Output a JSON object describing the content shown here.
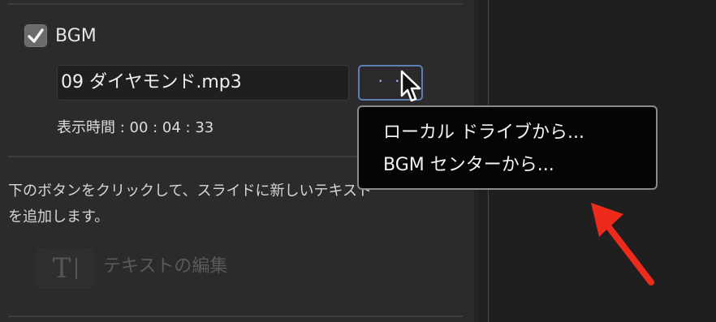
{
  "bgm": {
    "label": "BGM",
    "checked": true,
    "file_name": "09 ダイヤモンド.mp3",
    "browse_label": "· ·",
    "duration_text": "表示時間 : 00 : 04 : 33"
  },
  "text_section": {
    "description_line1": "下のボタンをクリックして、スライドに新しいテキスト",
    "description_line2": "を追加します。",
    "edit_button_icon": "T|",
    "edit_button_label": "テキストの編集"
  },
  "context_menu": {
    "items": [
      {
        "label": "ローカル ドライブから..."
      },
      {
        "label": "BGM センターから..."
      }
    ]
  },
  "colors": {
    "accent_blue": "#5d7fb6",
    "annotation_arrow": "#ee2a1c",
    "panel_bg": "#2b2b2b",
    "menu_bg": "#050505"
  },
  "icons": {
    "checkbox": "check-icon",
    "cursor": "mouse-pointer-icon",
    "annotation": "red-arrow-icon",
    "text": "text-t-icon"
  }
}
